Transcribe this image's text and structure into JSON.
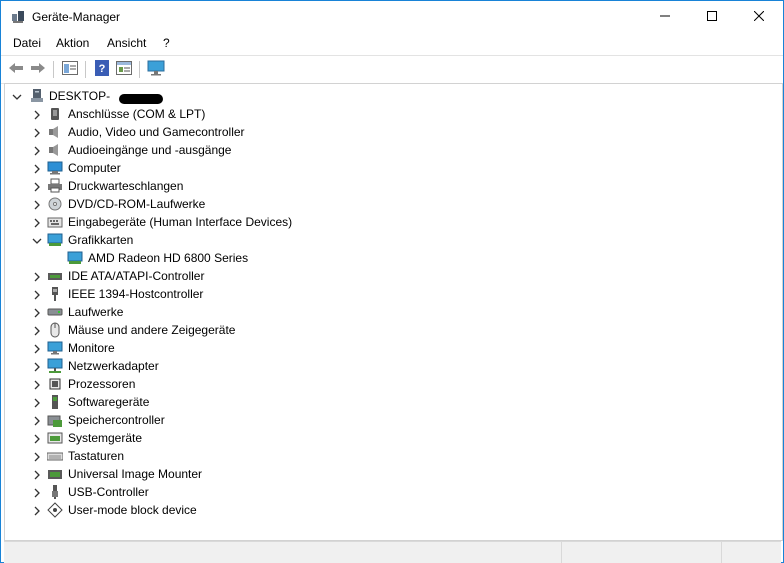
{
  "window": {
    "title": "Geräte-Manager",
    "icons": {
      "app": "device-manager-icon",
      "minimize": "minimize-icon",
      "maximize": "maximize-icon",
      "close": "close-icon"
    }
  },
  "menu": [
    {
      "label": "Datei"
    },
    {
      "label": "Aktion"
    },
    {
      "label": "Ansicht"
    },
    {
      "label": "?"
    }
  ],
  "toolbar": {
    "buttons": [
      "back-arrow-icon",
      "forward-arrow-icon",
      "properties-icon",
      "help-icon",
      "view-icon",
      "monitor-icon"
    ]
  },
  "tree": {
    "root": {
      "label": "DESKTOP-",
      "expanded": true
    },
    "items": [
      {
        "label": "Anschlüsse (COM & LPT)",
        "icon": "port-icon"
      },
      {
        "label": "Audio, Video und Gamecontroller",
        "icon": "speaker-icon"
      },
      {
        "label": "Audioeingänge und -ausgänge",
        "icon": "speaker-icon"
      },
      {
        "label": "Computer",
        "icon": "computer-icon"
      },
      {
        "label": "Druckwarteschlangen",
        "icon": "printer-icon"
      },
      {
        "label": "DVD/CD-ROM-Laufwerke",
        "icon": "disc-drive-icon"
      },
      {
        "label": "Eingabegeräte (Human Interface Devices)",
        "icon": "hid-icon"
      },
      {
        "label": "Grafikkarten",
        "icon": "display-adapter-icon",
        "expanded": true
      },
      {
        "label": "AMD Radeon HD 6800 Series",
        "icon": "display-adapter-icon",
        "child": true
      },
      {
        "label": "IDE ATA/ATAPI-Controller",
        "icon": "ide-controller-icon"
      },
      {
        "label": "IEEE 1394-Hostcontroller",
        "icon": "firewire-icon"
      },
      {
        "label": "Laufwerke",
        "icon": "disk-drive-icon"
      },
      {
        "label": "Mäuse und andere Zeigegeräte",
        "icon": "mouse-icon"
      },
      {
        "label": "Monitore",
        "icon": "monitor-icon"
      },
      {
        "label": "Netzwerkadapter",
        "icon": "network-adapter-icon"
      },
      {
        "label": "Prozessoren",
        "icon": "processor-icon"
      },
      {
        "label": "Softwaregeräte",
        "icon": "software-device-icon"
      },
      {
        "label": "Speichercontroller",
        "icon": "storage-controller-icon"
      },
      {
        "label": "Systemgeräte",
        "icon": "system-device-icon"
      },
      {
        "label": "Tastaturen",
        "icon": "keyboard-icon"
      },
      {
        "label": "Universal Image Mounter",
        "icon": "image-mounter-icon"
      },
      {
        "label": "USB-Controller",
        "icon": "usb-icon"
      },
      {
        "label": "User-mode block device",
        "icon": "block-device-icon"
      }
    ]
  },
  "colors": {
    "accent": "#1883d7",
    "status_bg": "#f0f0f0"
  }
}
